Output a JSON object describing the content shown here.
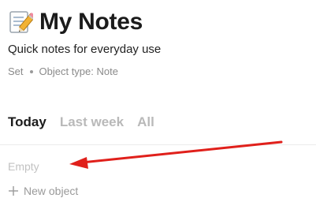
{
  "header": {
    "icon": "memo-pencil-icon",
    "title": "My Notes"
  },
  "description": "Quick notes for everyday use",
  "meta": {
    "kind": "Set",
    "object_type": "Object type: Note"
  },
  "tabs": [
    {
      "label": "Today",
      "active": true
    },
    {
      "label": "Last week",
      "active": false
    },
    {
      "label": "All",
      "active": false
    }
  ],
  "list": {
    "empty_text": "Empty",
    "new_object_label": "New object"
  },
  "colors": {
    "arrow": "#e0201b",
    "text_primary": "#1b1b1b",
    "text_muted": "#8a8a8a",
    "tab_inactive": "#b9b9b9"
  }
}
